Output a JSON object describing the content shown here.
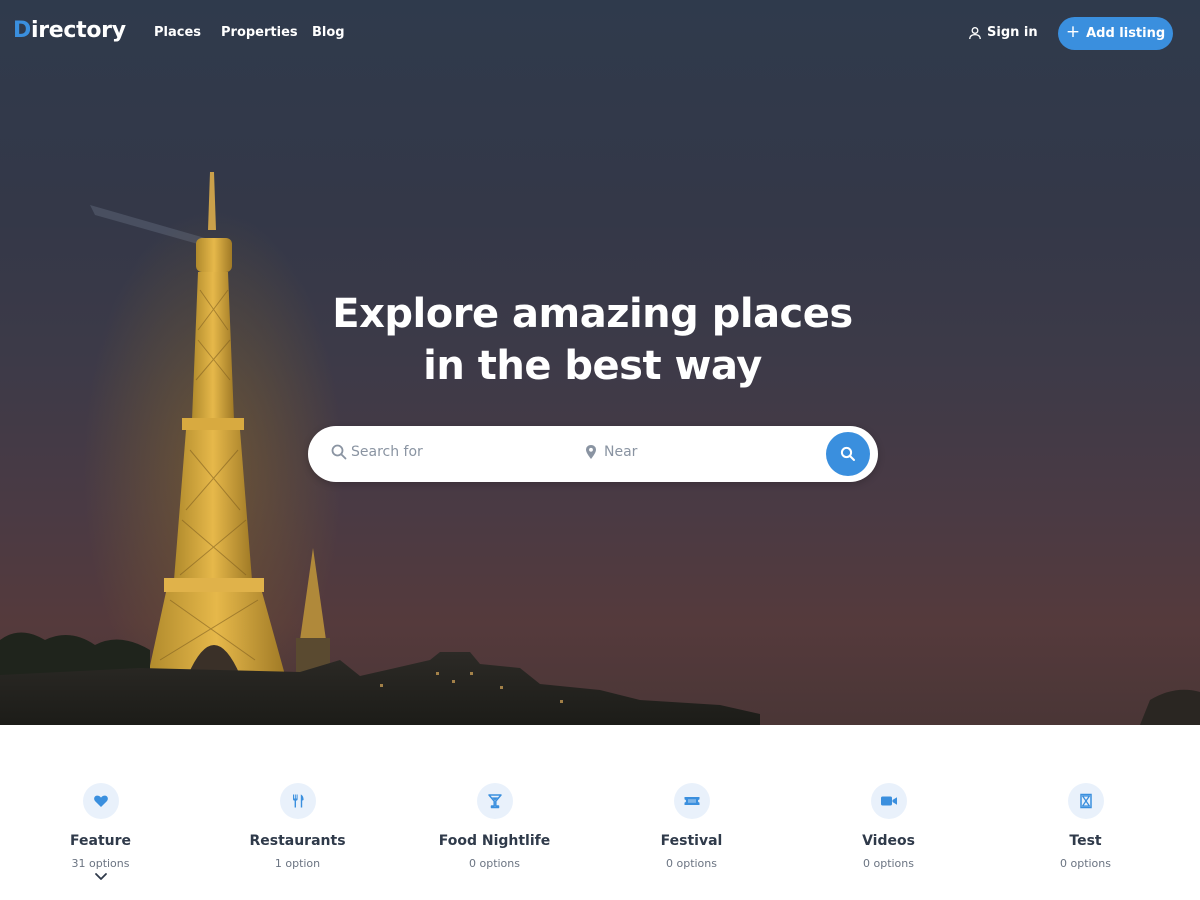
{
  "brand": {
    "logo_first": "D",
    "logo_rest": "irectory"
  },
  "nav": {
    "links": [
      {
        "label": "Places"
      },
      {
        "label": "Properties"
      },
      {
        "label": "Blog"
      }
    ],
    "signin_label": "Sign in",
    "signin_icon": "user-icon",
    "add_listing_label": "Add listing",
    "add_listing_icon": "plus-icon"
  },
  "hero": {
    "headline_line1": "Explore amazing places",
    "headline_line2": "in the best way"
  },
  "search": {
    "query_placeholder": "Search for",
    "query_value": "",
    "query_icon": "search-icon",
    "near_placeholder": "Near",
    "near_value": "",
    "near_icon": "map-pin-icon",
    "submit_icon": "search-icon"
  },
  "categories": [
    {
      "name": "Feature",
      "count": "31 options",
      "icon": "heart-icon"
    },
    {
      "name": "Restaurants",
      "count": "1 option",
      "icon": "fork-knife-icon"
    },
    {
      "name": "Food Nightlife",
      "count": "0 options",
      "icon": "cocktail-icon"
    },
    {
      "name": "Festival",
      "count": "0 options",
      "icon": "ticket-icon"
    },
    {
      "name": "Videos",
      "count": "0 options",
      "icon": "video-camera-icon"
    },
    {
      "name": "Test",
      "count": "0 options",
      "icon": "hourglass-icon"
    }
  ],
  "categories_more_icon": "chevron-down-icon",
  "colors": {
    "accent": "#3a8fde",
    "text_dark": "#2f3a4a",
    "icon_bg": "#e9f1fb"
  }
}
